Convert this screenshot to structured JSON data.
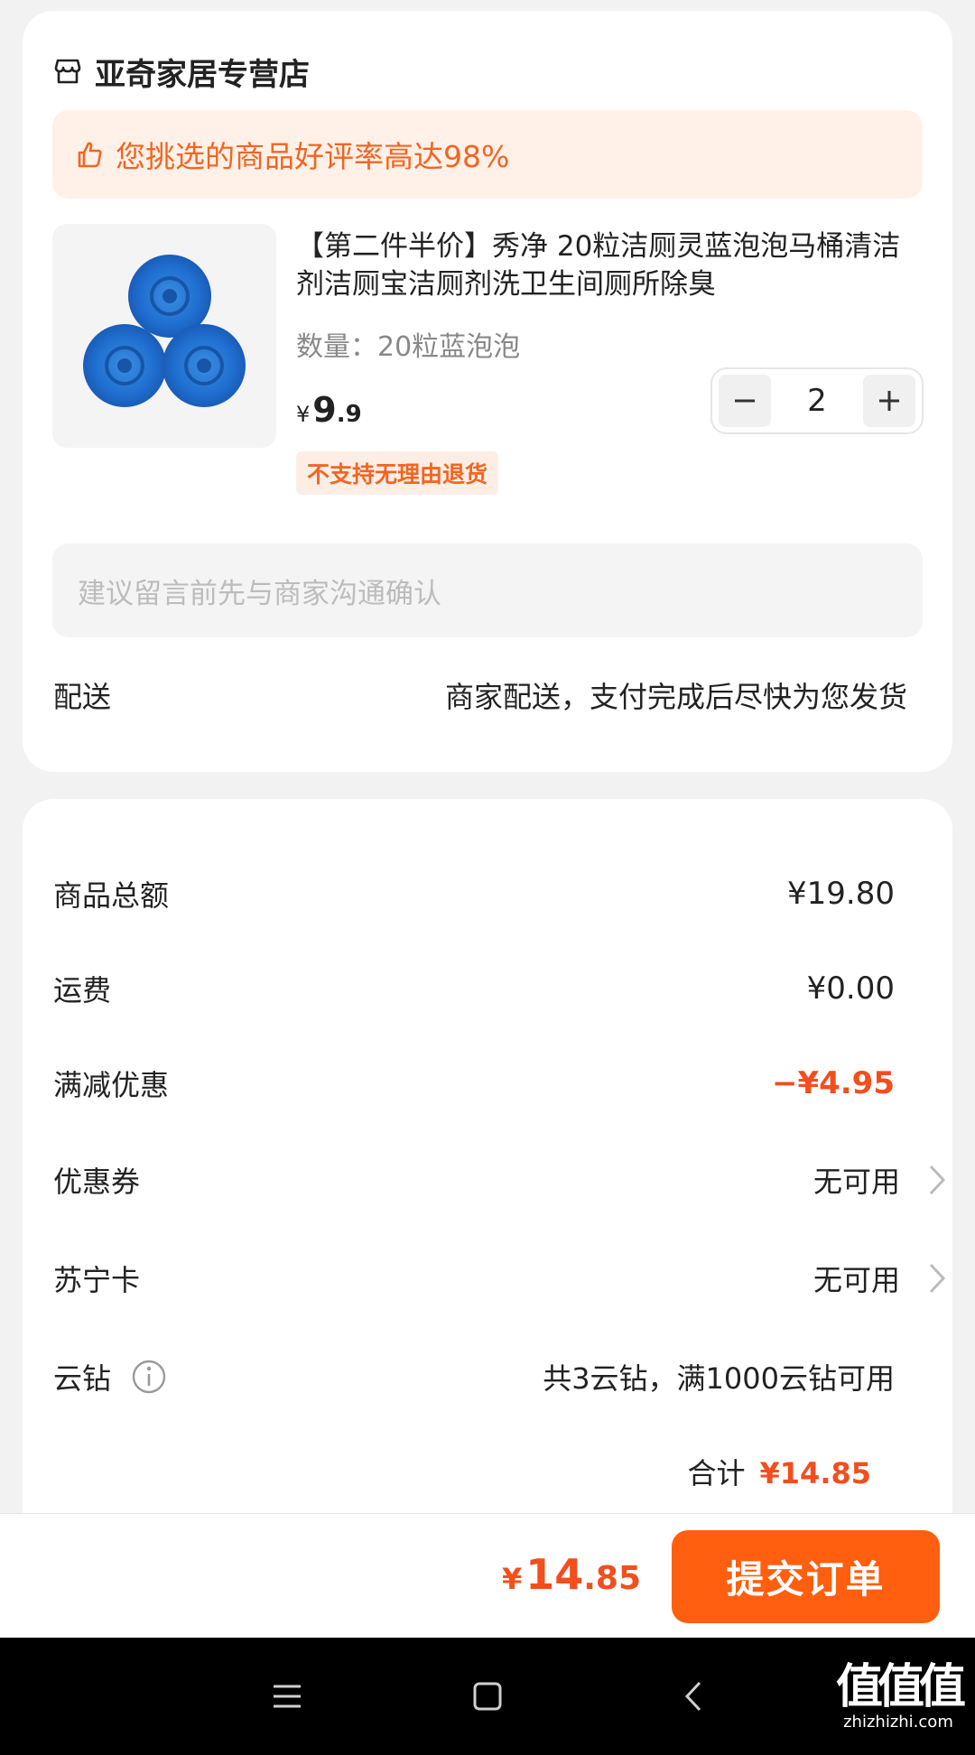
{
  "shop": {
    "name": "亚奇家居专营店",
    "rating_banner": "您挑选的商品好评率高达98%"
  },
  "product": {
    "title": "【第二件半价】秀净 20粒洁厕灵蓝泡泡马桶清洁剂洁厕宝洁厕剂洗卫生间厕所除臭",
    "spec": "数量：20粒蓝泡泡",
    "price_currency": "¥",
    "price_int": "9",
    "price_dec": ".9",
    "quantity": "2",
    "return_tag": "不支持无理由退货"
  },
  "message": {
    "placeholder": "建议留言前先与商家沟通确认"
  },
  "delivery": {
    "label": "配送",
    "value": "商家配送，支付完成后尽快为您发货"
  },
  "summary": {
    "goods_total_label": "商品总额",
    "goods_total_value": "¥19.80",
    "shipping_label": "运费",
    "shipping_value": "¥0.00",
    "discount_label": "满减优惠",
    "discount_value": "−¥4.95",
    "coupon_label": "优惠券",
    "coupon_value": "无可用",
    "card_label": "苏宁卡",
    "card_value": "无可用",
    "diamond_label": "云钻",
    "diamond_value": "共3云钻，满1000云钻可用",
    "total_label": "合计",
    "total_value": "¥14.85"
  },
  "footer": {
    "pay_currency": "¥",
    "pay_int": "14",
    "pay_dec": ".85",
    "submit_label": "提交订单"
  },
  "watermark": {
    "big": "值值值",
    "small": "zhizhizhi.com"
  },
  "colors": {
    "accent": "#f26522",
    "discount": "#f24e1e",
    "submit": "#ff5f0f"
  },
  "icons": [
    "shop-icon",
    "thumb-up-icon",
    "minus-icon",
    "plus-icon",
    "chevron-right-icon",
    "info-icon",
    "menu-icon",
    "home-square-icon",
    "back-icon"
  ]
}
